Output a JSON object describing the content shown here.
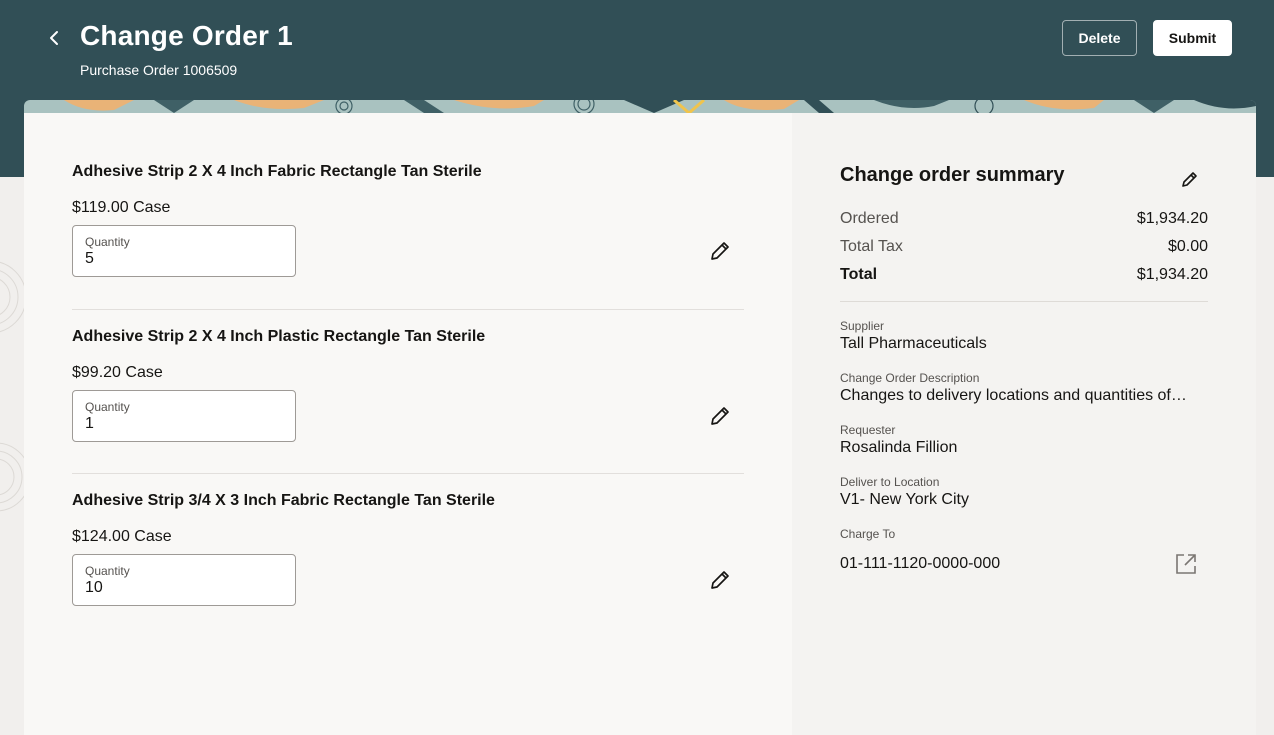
{
  "header": {
    "title": "Change Order 1",
    "subtitle": "Purchase Order 1006509",
    "delete_label": "Delete",
    "submit_label": "Submit"
  },
  "items": [
    {
      "name": "Adhesive Strip 2 X 4 Inch Fabric Rectangle Tan Sterile",
      "price": "$119.00 Case",
      "quantity_label": "Quantity",
      "quantity": "5"
    },
    {
      "name": "Adhesive Strip 2 X 4 Inch Plastic Rectangle Tan Sterile",
      "price": "$99.20 Case",
      "quantity_label": "Quantity",
      "quantity": "1"
    },
    {
      "name": "Adhesive Strip 3/4 X 3 Inch Fabric Rectangle Tan Sterile",
      "price": "$124.00 Case",
      "quantity_label": "Quantity",
      "quantity": "10"
    }
  ],
  "summary": {
    "title": "Change order summary",
    "rows": [
      {
        "label": "Ordered",
        "value": "$1,934.20"
      },
      {
        "label": "Total Tax",
        "value": "$0.00"
      },
      {
        "label": "Total",
        "value": "$1,934.20"
      }
    ],
    "fields": [
      {
        "label": "Supplier",
        "value": "Tall Pharmaceuticals"
      },
      {
        "label": "Change Order Description",
        "value": "Changes to delivery locations and quantities of…"
      },
      {
        "label": "Requester",
        "value": "Rosalinda Fillion"
      },
      {
        "label": "Deliver to Location",
        "value": "V1- New York City"
      },
      {
        "label": "Charge To",
        "value": "01-111-1120-0000-000"
      }
    ]
  },
  "icons": {
    "back": "chevron-left-icon",
    "edit": "pencil-icon",
    "external": "open-external-icon"
  },
  "colors": {
    "header_bg": "#314f56",
    "left_panel_bg": "#f9f8f6",
    "right_panel_bg": "#f4f3f1",
    "page_bg": "#f1efed"
  }
}
